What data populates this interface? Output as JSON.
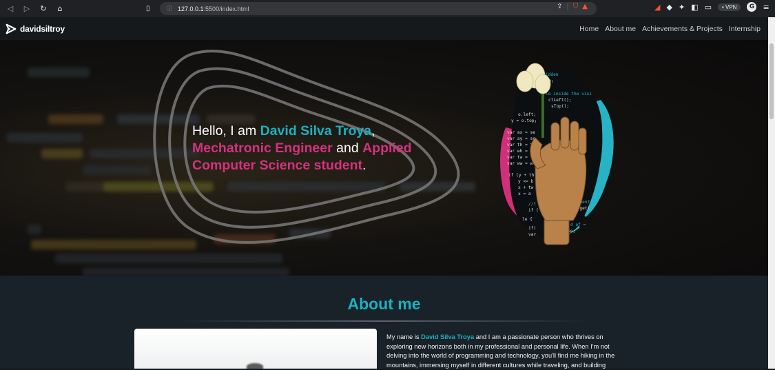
{
  "browser": {
    "url_host": "127.0.0.1",
    "url_path": ":5500/index.html",
    "vpn_label": "• VPN",
    "profile_initial": "G"
  },
  "navbar": {
    "brand": "davidsiltroy",
    "links": [
      "Home",
      "About me",
      "Achievements & Projects",
      "Internship"
    ]
  },
  "hero": {
    "greeting": "Hello, I am ",
    "name": "David Silva Troya",
    "comma": ",",
    "role1": "Mechatronic Engineer",
    "and": " and ",
    "role2": "Applied Computer Science student",
    "period": ".",
    "code_lines": [
      "ir hidden",
      "= false;",
      "le inside the visi",
      "ctLeft();",
      "sTop();",
      "o.left;",
      "y = o.top;",
      "var ax = se",
      "var ay = se",
      "var th = t.",
      "var wh = w.",
      "var tw = t.",
      "var ww = w.",
      "if (y + th",
      "y <= b",
      "x + tw",
      "x = a",
      "//t",
      "if (",
      "le {",
      "if(",
      "var",
      "lement",
      "idget(",
      "d of =",
      "se;"
    ]
  },
  "about": {
    "title": "About me",
    "text_pre": "My name is ",
    "text_name": "David Silva Troya",
    "text_post": " and I am a passionate person who thrives on exploring new horizons both in my professional and personal life. When I'm not delving into the world of programming and technology, you'll find me hiking in the mountains, immersing myself in different cultures while traveling, and building"
  },
  "colors": {
    "accent_cyan": "#1fb0c0",
    "accent_pink": "#d3327e",
    "nav_bg": "#16191c",
    "about_bg": "#1a2229"
  }
}
